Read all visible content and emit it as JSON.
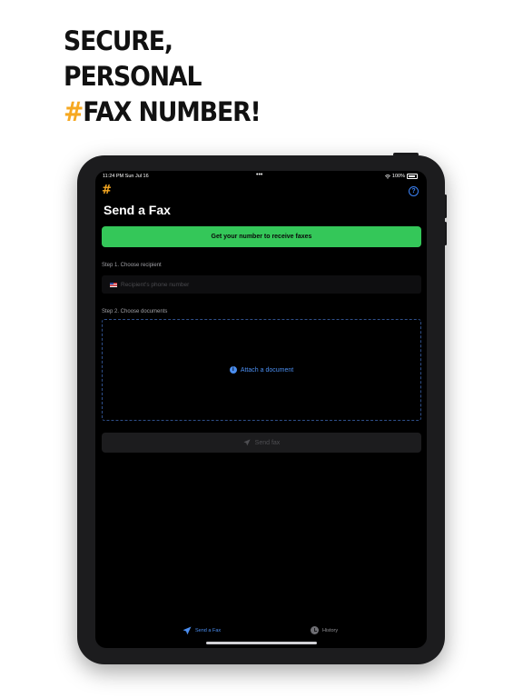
{
  "headline": {
    "line1": "SECURE,",
    "line2": "PERSONAL",
    "line3_hash": "#",
    "line3_rest": "FAX NUMBER!"
  },
  "colors": {
    "accent": "#f6a821",
    "green": "#34c759",
    "blue": "#4b8ef0",
    "background": "#000000"
  },
  "statusbar": {
    "time": "11:24 PM   Sun Jul 16",
    "dots": "•••",
    "battery_text": "100%"
  },
  "app": {
    "logo": "#",
    "help_icon": "question-circle-icon",
    "help_glyph": "?",
    "title": "Send a Fax",
    "get_number_label": "Get your number to receive faxes",
    "step1_label": "Step 1. Choose recipient",
    "recipient_placeholder": "Recipient's phone number",
    "step2_label": "Step 2. Choose documents",
    "attach_label": "Attach a document",
    "attach_icon": "info-icon",
    "send_label": "Send fax"
  },
  "tabbar": {
    "items": [
      {
        "label": "Send a Fax",
        "icon": "paper-plane-icon",
        "active": true
      },
      {
        "label": "History",
        "icon": "clock-icon",
        "active": false
      }
    ]
  }
}
